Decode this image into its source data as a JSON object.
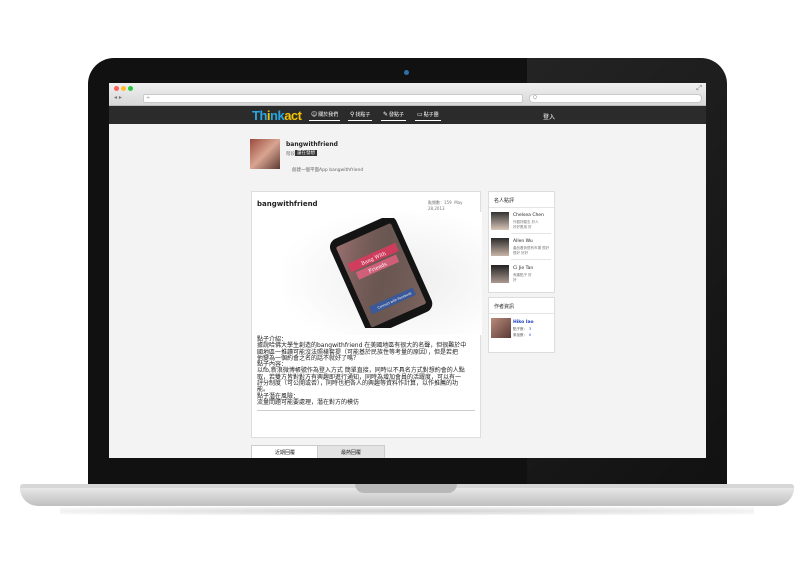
{
  "browser": {
    "nav": "◂ ▸",
    "url_placeholder": "+",
    "search_placeholder": "Q"
  },
  "site": {
    "logo_part1": "Th",
    "logo_i": "i",
    "logo_part2": "nk",
    "logo_part3": "act",
    "nav_items": [
      {
        "label": "關於我們",
        "icon": "person-icon"
      },
      {
        "label": "找點子",
        "icon": "search-icon"
      },
      {
        "label": "發點子",
        "icon": "pencil-icon"
      },
      {
        "label": "點子團",
        "icon": "chat-icon"
      }
    ],
    "login": "登入"
  },
  "idea": {
    "name": "bangwithfriend",
    "meta_label": "階段",
    "status": "還在發想",
    "creator": "創建一個平面App bangwithfriend"
  },
  "card": {
    "title": "bangwithfriend",
    "views": "點閱數：159",
    "date": "May 28,2013",
    "description_lines": [
      "點子介紹：",
      "據說哈佛大學生創造的bangwithfriend 在美國地區有很大的名聲，但很難於中",
      "國地區一推讀可能沒法照樣套提（可能基於民族性等考量的原因），但是若把",
      "他變為一個約會之名的話不就好了嗎？",
      "點子內容：",
      "以fb,新浪微博帳號作為登入方式 簡單直接，同時以不具名方式對想約會的人點",
      "取，若雙方皆對對方有興趣即進行通知，同時為增加會員的活躍度，可以有一",
      "評分制度（可公開或否），同時也把各人的興趣等資料作計算，以作推薦的功",
      "能。",
      "點子潛在風險：",
      "流量問題可能要處理，潛在對方的模仿"
    ],
    "phone_banner1": "Bang With",
    "phone_banner2": "Friends",
    "phone_button": "Connect with Facebook"
  },
  "sidebar": {
    "celeb_title": "名人點評",
    "people": [
      {
        "name": "Chelsea Chen",
        "sub": "外觀好勵志 好人",
        "sub2": "好好應用 好"
      },
      {
        "name": "Allen Wu",
        "sub": "產品看到很有市場 很好",
        "sub2": "很好 好好"
      },
      {
        "name": "Ci Jie Tan",
        "sub": "有趣點子 好",
        "sub2": "好"
      }
    ],
    "author_title": "作者資訊",
    "author": {
      "name": "Hiko Iao",
      "stat1_label": "點子數：",
      "stat1_value": "3",
      "stat2_label": "參加數：",
      "stat2_value": "0"
    }
  },
  "tabs": {
    "recent": "近期回覆",
    "hot": "最熱回覆"
  }
}
